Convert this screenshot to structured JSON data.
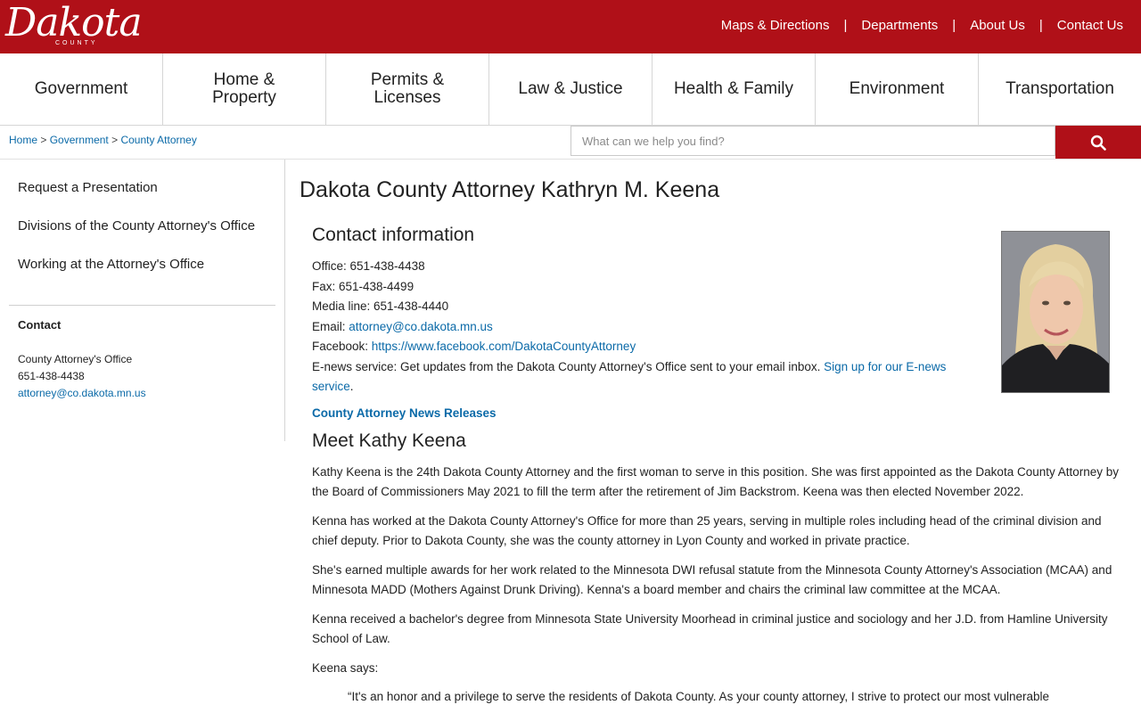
{
  "header": {
    "logo_text": "Dakota",
    "logo_sub": "COUNTY",
    "top_links": [
      "Maps & Directions",
      "Departments",
      "About Us",
      "Contact Us"
    ]
  },
  "nav": {
    "items": [
      "Government",
      "Home & Property",
      "Permits & Licenses",
      "Law & Justice",
      "Health & Family",
      "Environment",
      "Transportation"
    ]
  },
  "breadcrumb": {
    "home": "Home",
    "level1": "Government",
    "level2": "County Attorney",
    "separator": ">"
  },
  "search": {
    "placeholder": "What can we help you find?",
    "icon": "search-icon"
  },
  "sidebar": {
    "links": [
      "Request a Presentation",
      "Divisions of the County Attorney's Office",
      "Working at the Attorney's Office"
    ],
    "contact_heading": "Contact",
    "contact_name": "County Attorney's Office",
    "contact_phone": "651-438-4438",
    "contact_email": "attorney@co.dakota.mn.us"
  },
  "main": {
    "title": "Dakota County Attorney Kathryn M. Keena",
    "contact_heading": "Contact information",
    "office": "Office: 651-438-4438",
    "fax": "Fax: 651-438-4499",
    "media": "Media line: 651-438-4440",
    "email_label": "Email: ",
    "email": "attorney@co.dakota.mn.us",
    "facebook_label": "Facebook: ",
    "facebook": "https://www.facebook.com/DakotaCountyAttorney",
    "enews_text": "E-news service: Get updates from the Dakota County Attorney's Office sent to your email inbox. ",
    "enews_link": "Sign up for our E-news service",
    "enews_end": ".",
    "news_link": "County Attorney News Releases",
    "meet_heading": "Meet Kathy Keena",
    "paragraphs": [
      "Kathy Keena is the 24th Dakota County Attorney and the first woman to serve in this position. She was first appointed as the Dakota County Attorney by the Board of Commissioners May 2021 to fill the term after the retirement of Jim Backstrom. Keena was then elected November 2022.",
      "Kenna has worked at the Dakota County Attorney's Office for more than 25 years, serving in multiple roles including head of the criminal division and chief deputy. Prior to Dakota County, she was the county attorney in Lyon County and worked in private practice.",
      "She's earned multiple awards for her work related to the Minnesota DWI refusal statute from the Minnesota County Attorney's Association (MCAA) and Minnesota MADD (Mothers Against Drunk Driving). Kenna's a board member and chairs the criminal law committee at the MCAA.",
      "Kenna received a bachelor's degree from Minnesota State University Moorhead in criminal justice and sociology and her J.D. from Hamline University School of Law.",
      "Keena says:"
    ],
    "quote": "“It's an honor and a privilege to serve the residents of Dakota County. As your county attorney, I strive to protect our most vulnerable"
  },
  "colors": {
    "brand_red": "#b01018",
    "link_blue": "#0b6aa8"
  }
}
